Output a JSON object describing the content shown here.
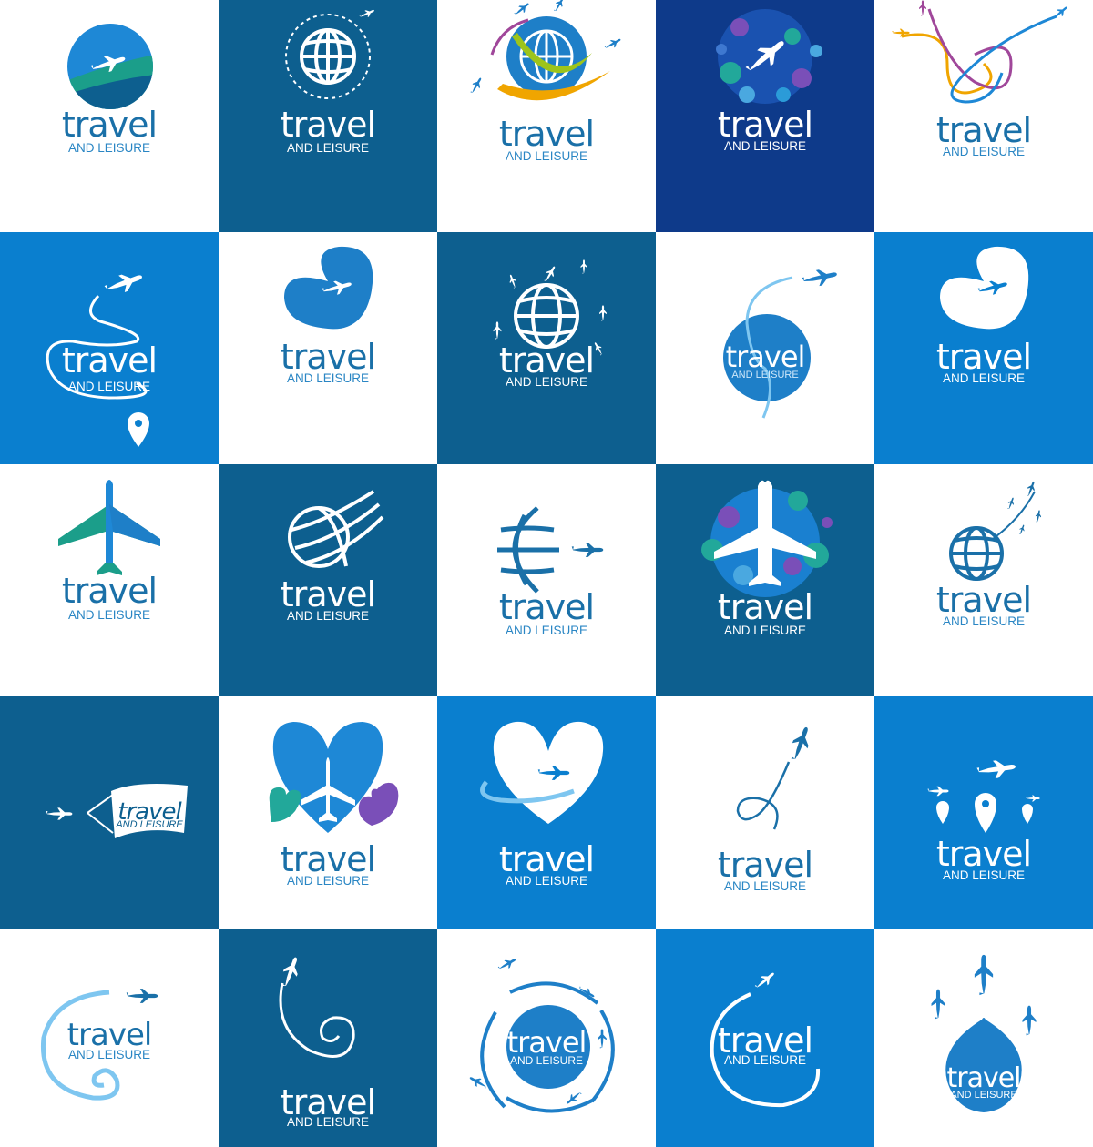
{
  "palette": {
    "white": "#ffffff",
    "teal_blue": "#0d5f8f",
    "sky_blue": "#0a7fcf",
    "navy": "#0e3a8a",
    "text_blue": "#1a70a8"
  },
  "tiles": [
    {
      "title": "travel",
      "subtitle": "AND LEISURE",
      "icon": "globe-plane-icon",
      "background": "#ffffff"
    },
    {
      "title": "travel",
      "subtitle": "AND LEISURE",
      "icon": "globe-orbit-icon",
      "background": "#0d5f8f"
    },
    {
      "title": "travel",
      "subtitle": "AND LEISURE",
      "icon": "globe-planes-ribbon-icon",
      "background": "#ffffff"
    },
    {
      "title": "travel",
      "subtitle": "AND LEISURE",
      "icon": "plane-bubbles-icon",
      "background": "#0e3a8a"
    },
    {
      "title": "travel",
      "subtitle": "AND LEISURE",
      "icon": "plane-loops-icon",
      "background": "#ffffff"
    },
    {
      "title": "travel",
      "subtitle": "AND LEISURE",
      "icon": "plane-route-pin-icon",
      "background": "#0a7fcf"
    },
    {
      "title": "travel",
      "subtitle": "AND LEISURE",
      "icon": "plane-bean-icon",
      "background": "#ffffff"
    },
    {
      "title": "travel",
      "subtitle": "AND LEISURE",
      "icon": "globe-planes-icon",
      "background": "#0d5f8f"
    },
    {
      "title": "travel",
      "subtitle": "AND LEISURE",
      "icon": "plane-circle-trail-icon",
      "background": "#ffffff"
    },
    {
      "title": "travel",
      "subtitle": "AND LEISURE",
      "icon": "plane-bean-icon",
      "background": "#0a7fcf"
    },
    {
      "title": "travel",
      "subtitle": "AND LEISURE",
      "icon": "airplane-icon",
      "background": "#ffffff"
    },
    {
      "title": "travel",
      "subtitle": "AND LEISURE",
      "icon": "swoosh-globe-icon",
      "background": "#0d5f8f"
    },
    {
      "title": "travel",
      "subtitle": "AND LEISURE",
      "icon": "half-globe-plane-icon",
      "background": "#ffffff"
    },
    {
      "title": "travel",
      "subtitle": "AND LEISURE",
      "icon": "plane-bubbles-icon",
      "background": "#0d5f8f"
    },
    {
      "title": "travel",
      "subtitle": "AND LEISURE",
      "icon": "globe-planes-icon",
      "background": "#ffffff"
    },
    {
      "title": "travel",
      "subtitle": "AND LEISURE",
      "icon": "plane-banner-icon",
      "background": "#0d5f8f"
    },
    {
      "title": "travel",
      "subtitle": "AND LEISURE",
      "icon": "hearts-plane-icon",
      "background": "#ffffff"
    },
    {
      "title": "travel",
      "subtitle": "AND LEISURE",
      "icon": "heart-plane-icon",
      "background": "#0a7fcf"
    },
    {
      "title": "travel",
      "subtitle": "AND LEISURE",
      "icon": "plane-loop-trail-icon",
      "background": "#ffffff"
    },
    {
      "title": "travel",
      "subtitle": "AND LEISURE",
      "icon": "planes-pins-icon",
      "background": "#0a7fcf"
    },
    {
      "title": "travel",
      "subtitle": "AND LEISURE",
      "icon": "plane-spiral-icon",
      "background": "#ffffff"
    },
    {
      "title": "travel",
      "subtitle": "AND LEISURE",
      "icon": "plane-spiral-icon",
      "background": "#0d5f8f"
    },
    {
      "title": "travel",
      "subtitle": "AND LEISURE",
      "icon": "orbiting-planes-icon",
      "background": "#ffffff"
    },
    {
      "title": "travel",
      "subtitle": "AND LEISURE",
      "icon": "plane-arc-icon",
      "background": "#0a7fcf"
    },
    {
      "title": "travel",
      "subtitle": "AND LEISURE",
      "icon": "planes-drop-icon",
      "background": "#ffffff"
    }
  ]
}
